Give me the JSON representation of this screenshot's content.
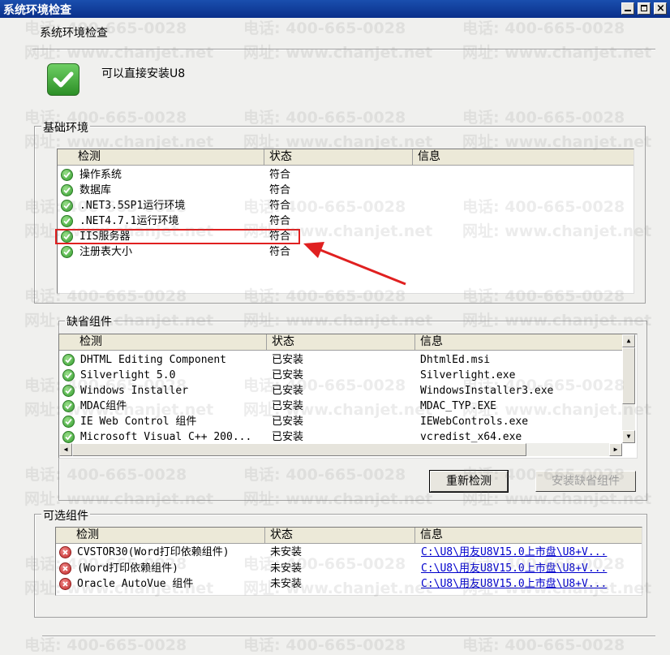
{
  "window": {
    "title": "系统环境检查",
    "controls": {
      "minimize": "_",
      "maximize": "□",
      "close": "×"
    }
  },
  "header": {
    "title": "系统环境检查",
    "status_text": "可以直接安装U8",
    "status_icon": "check-icon"
  },
  "watermark": {
    "phone": "电话: 400-665-0028",
    "site": "网址: www.chanjet.net"
  },
  "basic_env": {
    "label": "基础环境",
    "columns": [
      "检测",
      "状态",
      "信息"
    ],
    "rows": [
      {
        "icon": "ok",
        "name": "操作系统",
        "status": "符合",
        "info": ""
      },
      {
        "icon": "ok",
        "name": "数据库",
        "status": "符合",
        "info": ""
      },
      {
        "icon": "ok",
        "name": ".NET3.5SP1运行环境",
        "status": "符合",
        "info": ""
      },
      {
        "icon": "ok",
        "name": ".NET4.7.1运行环境",
        "status": "符合",
        "info": ""
      },
      {
        "icon": "ok",
        "name": "IIS服务器",
        "status": "符合",
        "info": ""
      },
      {
        "icon": "ok",
        "name": "注册表大小",
        "status": "符合",
        "info": ""
      }
    ]
  },
  "default_components": {
    "label": "缺省组件",
    "columns": [
      "检测",
      "状态",
      "信息"
    ],
    "rows": [
      {
        "icon": "ok",
        "name": "DHTML Editing Component",
        "status": "已安装",
        "info": "DhtmlEd.msi"
      },
      {
        "icon": "ok",
        "name": "Silverlight 5.0",
        "status": "已安装",
        "info": "Silverlight.exe"
      },
      {
        "icon": "ok",
        "name": "Windows Installer",
        "status": "已安装",
        "info": "WindowsInstaller3.exe"
      },
      {
        "icon": "ok",
        "name": "MDAC组件",
        "status": "已安装",
        "info": "MDAC_TYP.EXE"
      },
      {
        "icon": "ok",
        "name": "IE Web Control 组件",
        "status": "已安装",
        "info": "IEWebControls.exe"
      },
      {
        "icon": "ok",
        "name": "Microsoft Visual C++ 200...",
        "status": "已安装",
        "info": "vcredist_x64.exe"
      }
    ],
    "recheck_button": "重新检测",
    "install_button": "安装缺省组件"
  },
  "optional_components": {
    "label": "可选组件",
    "columns": [
      "检测",
      "状态",
      "信息"
    ],
    "rows": [
      {
        "icon": "err",
        "name": "CVSTOR30(Word打印依赖组件)",
        "status": "未安装",
        "info": "C:\\U8\\用友U8V15.0上市盘\\U8+V..."
      },
      {
        "icon": "err",
        "name": "(Word打印依赖组件)",
        "status": "未安装",
        "info": "C:\\U8\\用友U8V15.0上市盘\\U8+V..."
      },
      {
        "icon": "err",
        "name": "Oracle AutoVue 组件",
        "status": "未安装",
        "info": "C:\\U8\\用友U8V15.0上市盘\\U8+V..."
      }
    ]
  },
  "annotation": {
    "highlight_color": "#e02020"
  }
}
